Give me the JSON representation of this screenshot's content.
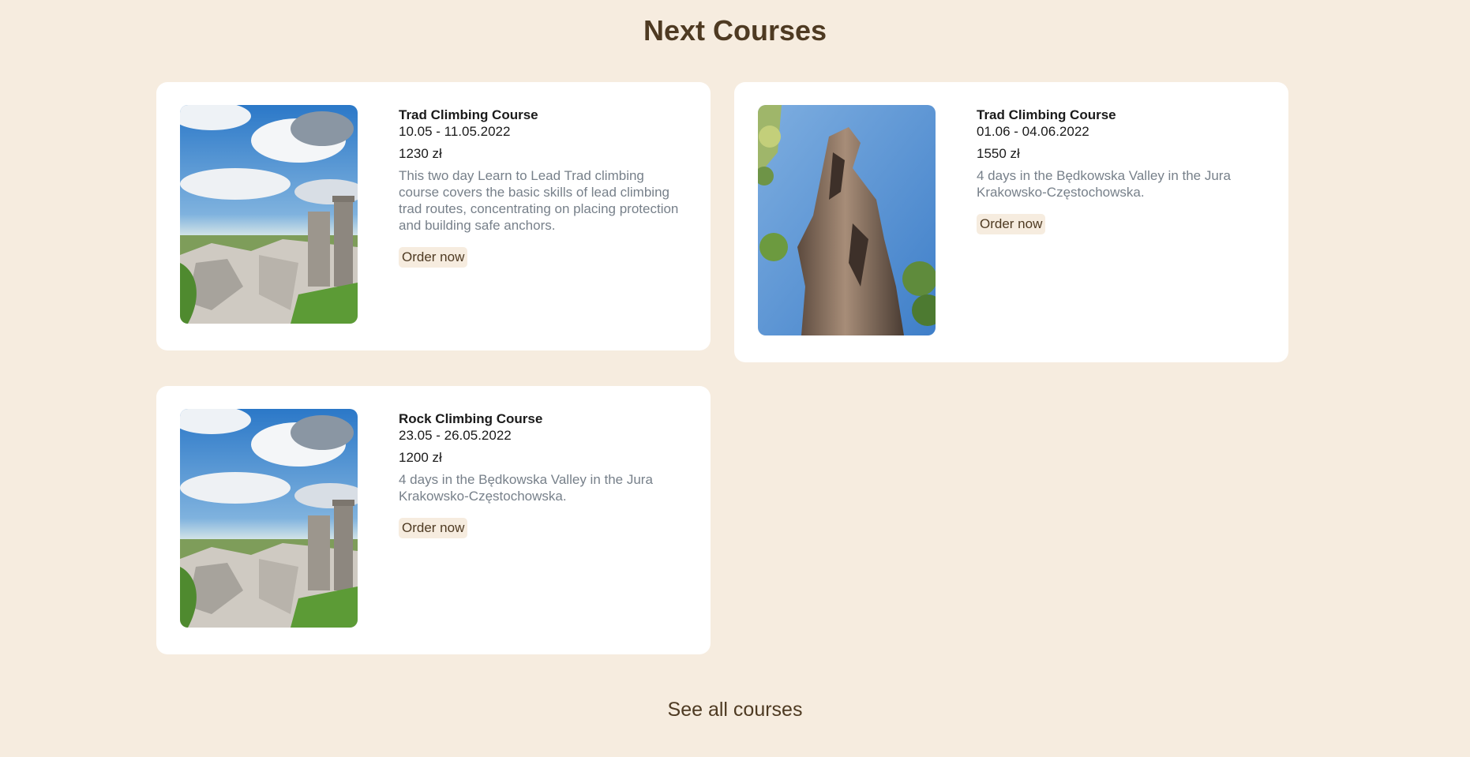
{
  "page": {
    "title": "Next Courses",
    "see_all_label": "See all courses"
  },
  "colors": {
    "background": "#f6ecdf",
    "heading": "#4e3a22",
    "card": "#ffffff",
    "description": "#77808a"
  },
  "courses": [
    {
      "name": "Trad Climbing Course",
      "dates": "10.05 - 11.05.2022",
      "price": "1230 zł",
      "description": "This two day Learn to Lead Trad climbing course covers the basic skills of lead climbing trad routes, concentrating on placing protection and building safe anchors.",
      "order_label": "Order now",
      "image": "castle-landscape-photo"
    },
    {
      "name": "Trad Climbing Course",
      "dates": "01.06 - 04.06.2022",
      "price": "1550 zł",
      "description": "4 days in the Będkowska Valley in the Jura Krakowsko-Częstochowska.",
      "order_label": "Order now",
      "image": "rock-tower-photo"
    },
    {
      "name": "Rock Climbing Course",
      "dates": "23.05 - 26.05.2022",
      "price": "1200 zł",
      "description": "4 days in the Będkowska Valley in the Jura Krakowsko-Częstochowska.",
      "order_label": "Order now",
      "image": "castle-landscape-photo"
    }
  ]
}
